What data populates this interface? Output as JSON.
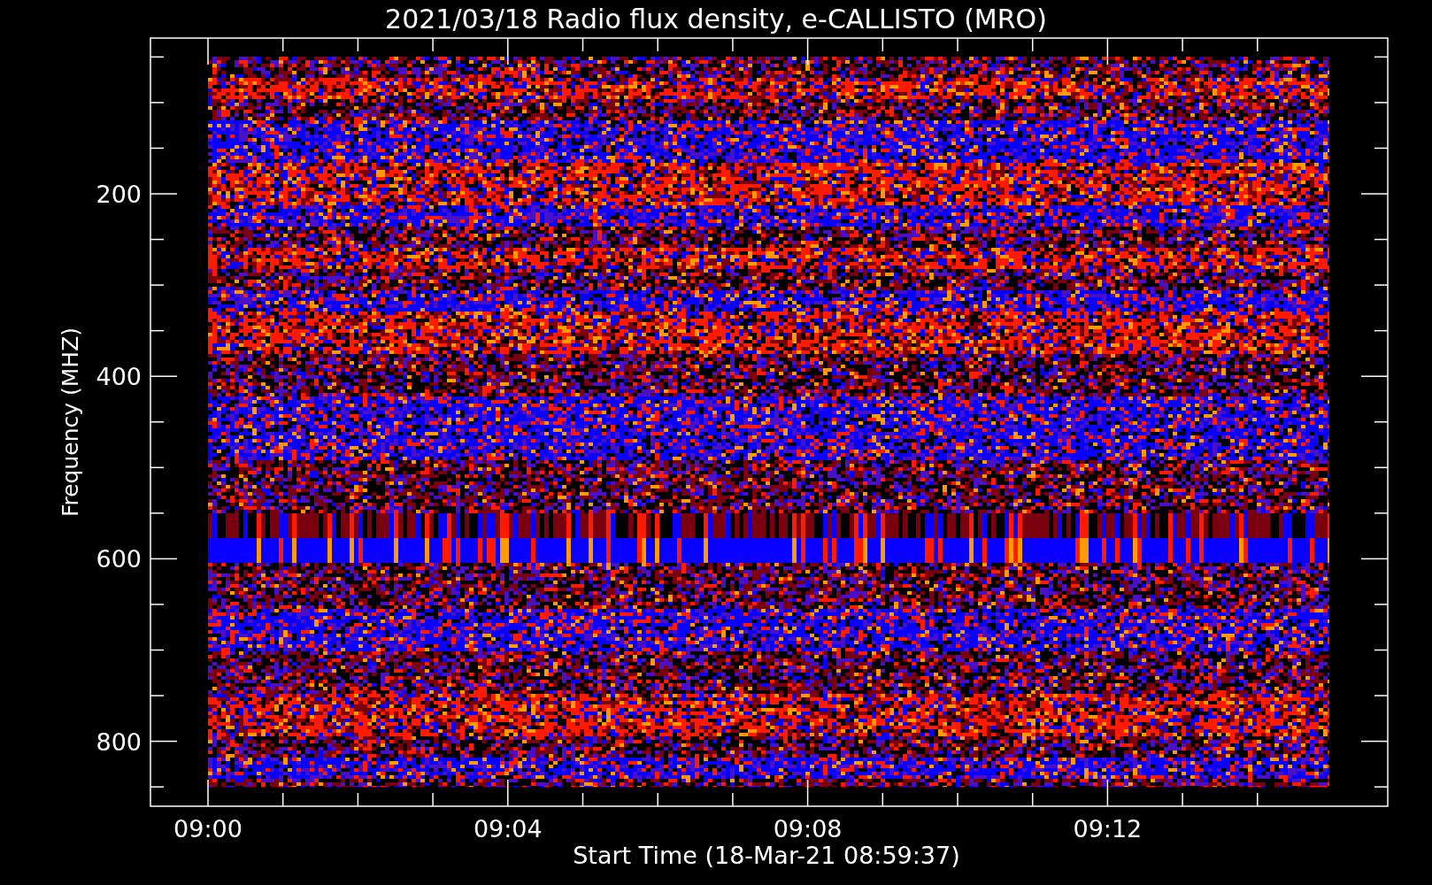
{
  "title": "2021/03/18  Radio flux density, e-CALLISTO (MRO)",
  "y_axis": {
    "label": "Frequency (MHZ)",
    "ticks": [
      "200",
      "400",
      "600",
      "800"
    ]
  },
  "x_axis": {
    "label": "Start Time (18-Mar-21 08:59:37)",
    "ticks": [
      "09:00",
      "09:04",
      "09:08",
      "09:12"
    ]
  }
}
